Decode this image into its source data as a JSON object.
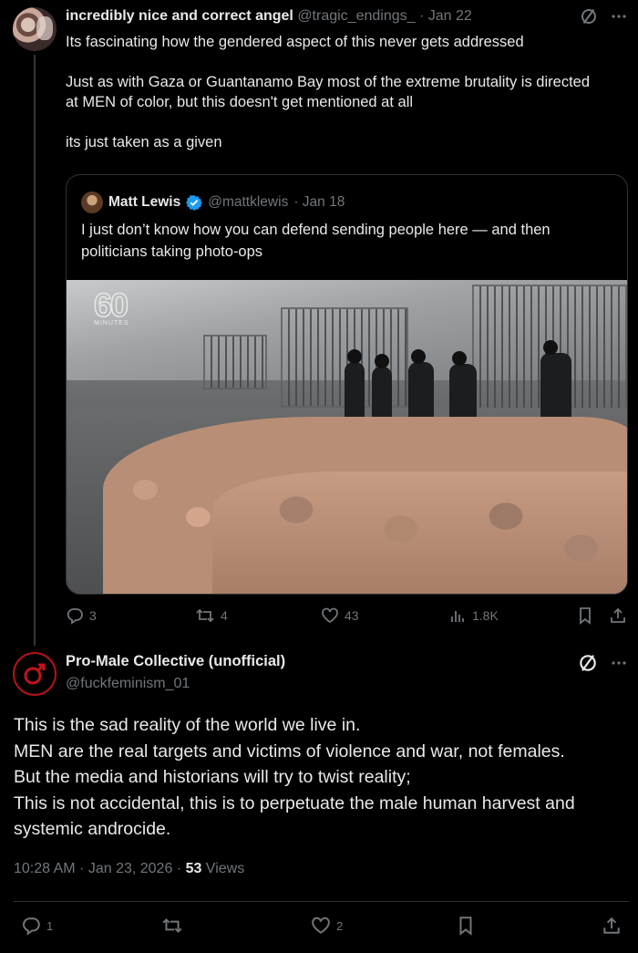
{
  "tweet1": {
    "display_name": "incredibly nice and correct angel",
    "handle": "@tragic_endings_",
    "date": "· Jan 22",
    "paragraphs": [
      "Its fascinating how the gendered aspect of this never gets addressed",
      "Just as with Gaza or Guantanamo Bay most of the extreme brutality is directed at MEN of color, but this doesn't get mentioned at all",
      "its just taken as a given"
    ],
    "icons": [
      "grok-icon",
      "more-icon"
    ],
    "stats": {
      "replies": "3",
      "reposts": "4",
      "likes": "43",
      "views": "1.8K"
    }
  },
  "quote": {
    "display_name": "Matt Lewis",
    "handle": "@mattklewis",
    "date": "· Jan 18",
    "text": "I just don’t know how you can defend sending people here — and then politicians taking photo-ops",
    "image_logo": "60",
    "image_logo_sub": "MINUTES"
  },
  "tweet2": {
    "display_name": "Pro-Male Collective (unofficial)",
    "handle": "@fuckfeminism_01",
    "lines": [
      "This is the sad reality of the world we live in.",
      "MEN are the real targets and victims of violence and war, not females.",
      "But the media and historians will try to twist reality;",
      "This is not accidental, this is to perpetuate the male human harvest and systemic androcide."
    ],
    "meta_time": "10:28 AM · Jan 23, 2026 · ",
    "views_count": "53",
    "views_label": " Views",
    "stats": {
      "replies": "1",
      "reposts": "",
      "likes": "2"
    }
  },
  "colors": {
    "muted": "#71767b",
    "text": "#e7e9ea",
    "verified": "#1d9bf0",
    "avatar_ring": "#b5121b"
  }
}
